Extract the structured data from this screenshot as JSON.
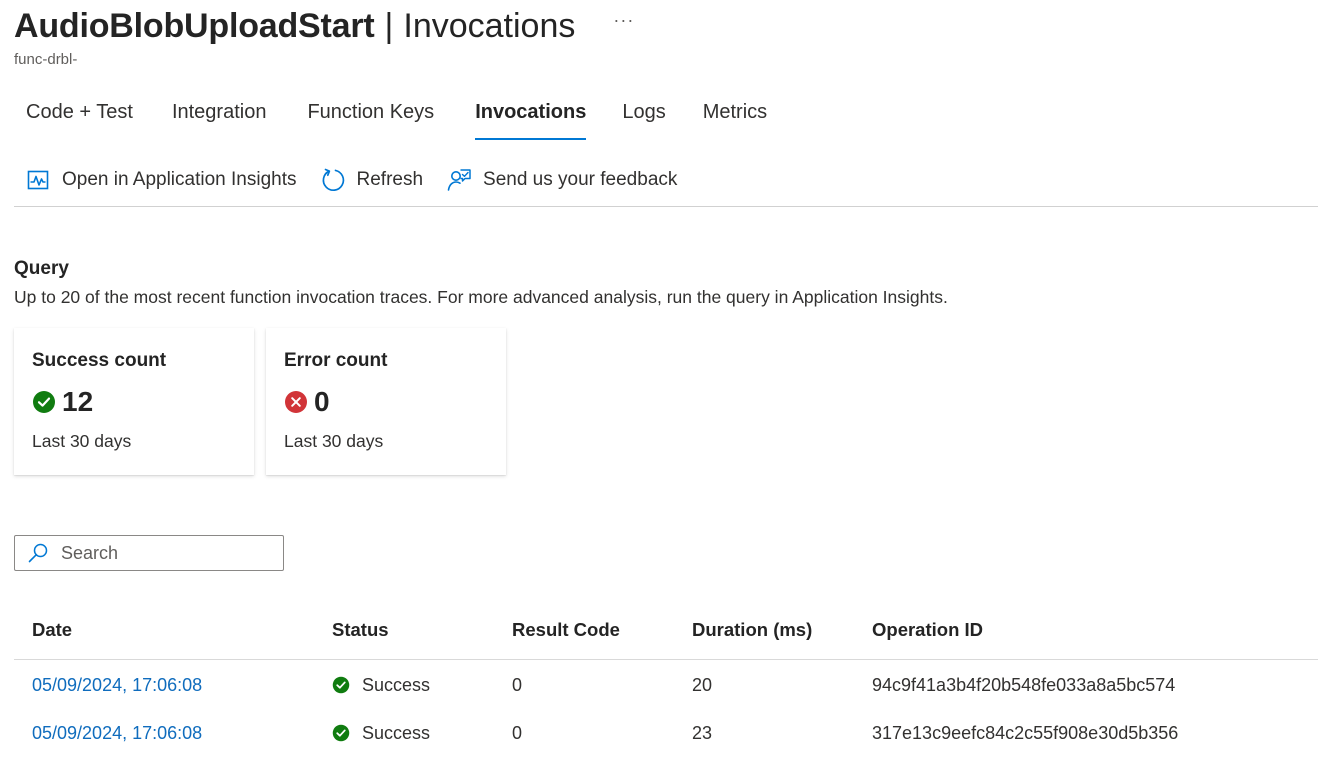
{
  "header": {
    "title": "AudioBlobUploadStart",
    "separator": "|",
    "page": "Invocations",
    "more": "···",
    "subtitle": "func-drbl-"
  },
  "tabs": [
    {
      "label": "Code + Test",
      "active": false
    },
    {
      "label": "Integration",
      "active": false
    },
    {
      "label": "Function Keys",
      "active": false
    },
    {
      "label": "Invocations",
      "active": true
    },
    {
      "label": "Logs",
      "active": false
    },
    {
      "label": "Metrics",
      "active": false
    }
  ],
  "toolbar": {
    "open_insights": {
      "label": "Open in Application Insights",
      "icon": "chart-icon"
    },
    "refresh": {
      "label": "Refresh",
      "icon": "refresh-icon"
    },
    "feedback": {
      "label": "Send us your feedback",
      "icon": "feedback-icon"
    }
  },
  "query": {
    "title": "Query",
    "description": "Up to 20 of the most recent function invocation traces. For more advanced analysis, run the query in Application Insights."
  },
  "cards": [
    {
      "title": "Success count",
      "value": "12",
      "period": "Last 30 days",
      "icon": "success-icon",
      "color": "#107c10"
    },
    {
      "title": "Error count",
      "value": "0",
      "period": "Last 30 days",
      "icon": "error-icon",
      "color": "#d13438"
    }
  ],
  "search": {
    "placeholder": "Search",
    "value": ""
  },
  "table": {
    "columns": [
      "Date",
      "Status",
      "Result Code",
      "Duration (ms)",
      "Operation ID"
    ],
    "rows": [
      {
        "date": "05/09/2024, 17:06:08",
        "status": "Success",
        "result_code": "0",
        "duration": "20",
        "operation_id": "94c9f41a3b4f20b548fe033a8a5bc574"
      },
      {
        "date": "05/09/2024, 17:06:08",
        "status": "Success",
        "result_code": "0",
        "duration": "23",
        "operation_id": "317e13c9eefc84c2c55f908e30d5b356"
      }
    ]
  },
  "colors": {
    "accent": "#0078d4",
    "link": "#0f6cbd",
    "success": "#107c10",
    "error": "#d13438"
  }
}
